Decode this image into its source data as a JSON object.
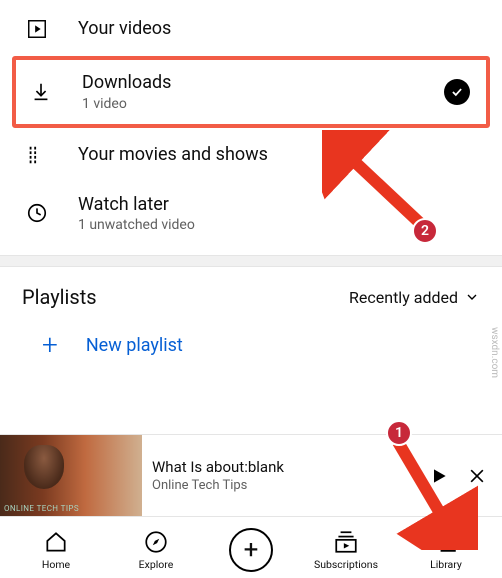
{
  "library": {
    "your_videos": {
      "title": "Your videos"
    },
    "downloads": {
      "title": "Downloads",
      "sub": "1 video"
    },
    "movies": {
      "title": "Your movies and shows"
    },
    "watch_later": {
      "title": "Watch later",
      "sub": "1 unwatched video"
    }
  },
  "playlists": {
    "heading": "Playlists",
    "sort": "Recently added",
    "new_label": "New playlist"
  },
  "mini_player": {
    "title": "What Is about:blank",
    "channel": "Online Tech Tips",
    "thumb_tag": "ONLINE TECH TIPS"
  },
  "nav": {
    "home": "Home",
    "explore": "Explore",
    "subs": "Subscriptions",
    "library": "Library"
  },
  "annotations": {
    "step1": "1",
    "step2": "2"
  },
  "watermark": "wsxdn.com"
}
